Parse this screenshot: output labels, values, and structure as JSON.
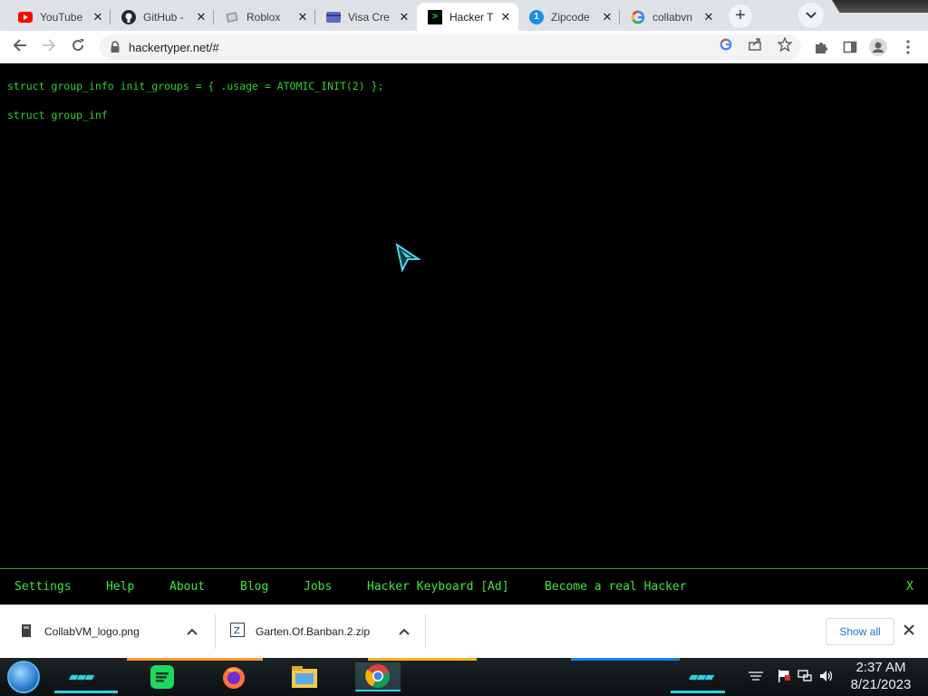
{
  "browser": {
    "tabs": [
      {
        "title": "YouTube",
        "icon": "youtube-icon"
      },
      {
        "title": "GitHub -",
        "icon": "github-icon"
      },
      {
        "title": "Roblox",
        "icon": "roblox-icon"
      },
      {
        "title": "Visa Cre",
        "icon": "card-icon"
      },
      {
        "title": "Hacker T",
        "icon": "terminal-icon",
        "active": true
      },
      {
        "title": "Zipcode",
        "icon": "info-badge-icon"
      },
      {
        "title": "collabvn",
        "icon": "google-icon"
      }
    ],
    "new_tab_symbol": "+",
    "url": "hackertyper.net/#"
  },
  "page": {
    "code_lines": [
      "struct group_info init_groups = { .usage = ATOMIC_INIT(2) };",
      "struct group_inf"
    ],
    "text_color": "#30d030"
  },
  "hacker_menu": {
    "items": [
      "Settings",
      "Help",
      "About",
      "Blog",
      "Jobs",
      "Hacker Keyboard [Ad]",
      "Become a real Hacker"
    ],
    "close_label": "X"
  },
  "downloads": {
    "items": [
      {
        "name": "CollabVM_logo.png",
        "icon": "file-icon"
      },
      {
        "name": "Garten.Of.Banban.2.zip",
        "icon": "zip-icon"
      }
    ],
    "show_all_label": "Show all"
  },
  "taskbar": {
    "time": "2:37 AM",
    "date": "8/21/2023",
    "apps": [
      "spotify-icon",
      "firefox-icon",
      "file-explorer-icon",
      "chrome-icon"
    ]
  },
  "colors": {
    "accent": "#1a73e8",
    "terminal_green": "#3ee63e",
    "taskbar_glow": "#2bd4e8"
  }
}
